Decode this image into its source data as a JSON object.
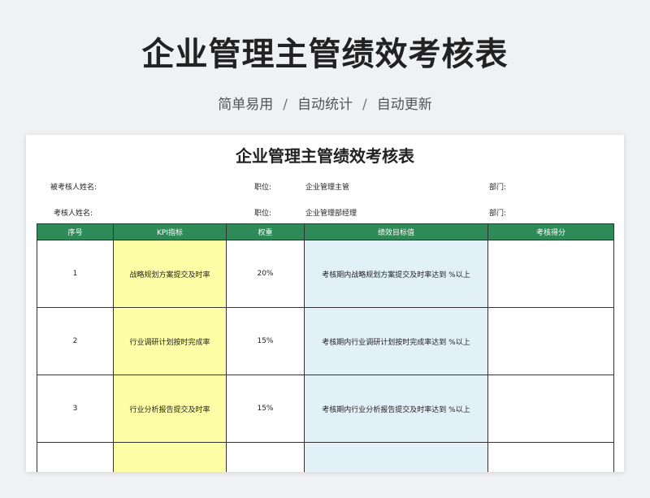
{
  "header": {
    "title": "企业管理主管绩效考核表",
    "subtitle_parts": [
      "简单易用",
      "自动统计",
      "自动更新"
    ],
    "separator": "/"
  },
  "sheet": {
    "title": "企业管理主管绩效考核表",
    "info": {
      "examinee_label": "被考核人姓名:",
      "position_label_1": "职位:",
      "position_value_1": "企业管理主管",
      "dept_label_1": "部门:",
      "examiner_label": "考核人姓名:",
      "position_label_2": "职位:",
      "position_value_2": "企业管理部经理",
      "dept_label_2": "部门:"
    },
    "table": {
      "headers": [
        "序号",
        "KPI指标",
        "权重",
        "绩效目标值",
        "考核得分"
      ],
      "rows": [
        {
          "no": "1",
          "kpi": "战略规划方案提交及时率",
          "weight": "20%",
          "target": "考核期内战略规划方案提交及时率达到    %以上",
          "score": ""
        },
        {
          "no": "2",
          "kpi": "行业调研计划按时完成率",
          "weight": "15%",
          "target": "考核期内行业调研计划按时完成率达到    %以上",
          "score": ""
        },
        {
          "no": "3",
          "kpi": "行业分析报告提交及时率",
          "weight": "15%",
          "target": "考核期内行业分析报告提交及时率达到    %以上",
          "score": ""
        }
      ]
    }
  }
}
